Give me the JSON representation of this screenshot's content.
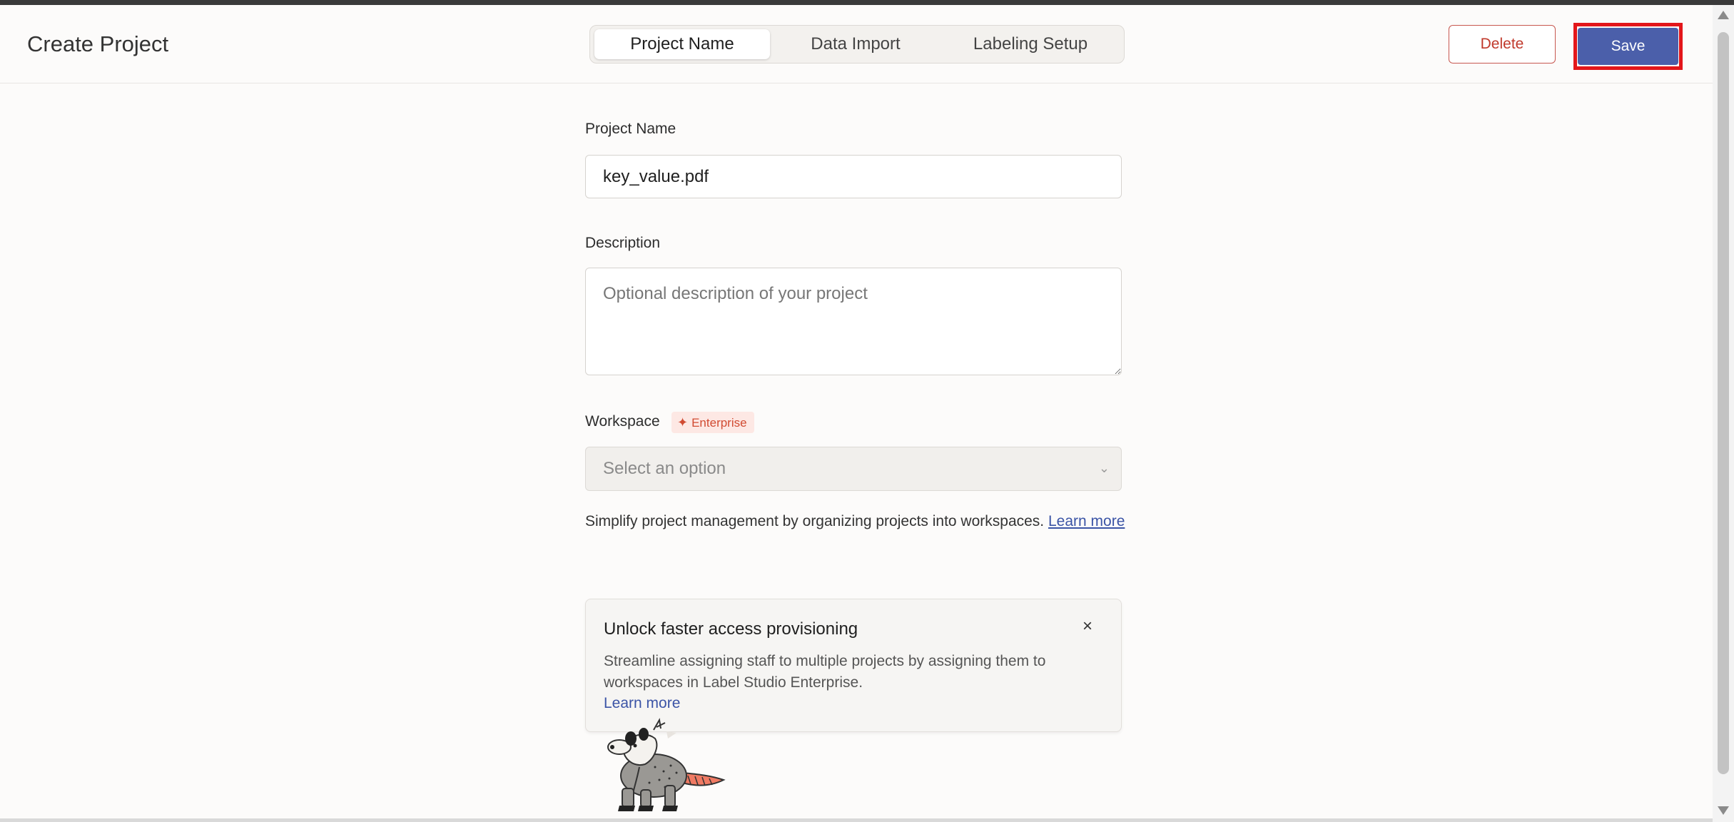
{
  "header": {
    "title": "Create Project",
    "tabs": [
      {
        "label": "Project Name",
        "active": true
      },
      {
        "label": "Data Import",
        "active": false
      },
      {
        "label": "Labeling Setup",
        "active": false
      }
    ],
    "delete_label": "Delete",
    "save_label": "Save"
  },
  "form": {
    "project_name": {
      "label": "Project Name",
      "value": "key_value.pdf"
    },
    "description": {
      "label": "Description",
      "placeholder": "Optional description of your project"
    },
    "workspace": {
      "label": "Workspace",
      "badge": "Enterprise",
      "placeholder": "Select an option",
      "help_text": "Simplify project management by organizing projects into workspaces.",
      "help_link": "Learn more"
    }
  },
  "promo": {
    "title": "Unlock faster access provisioning",
    "body": "Streamline assigning staff to multiple projects by assigning them to workspaces in Label Studio Enterprise.",
    "link": "Learn more",
    "close_symbol": "×"
  },
  "colors": {
    "accent": "#4b5faa",
    "danger": "#c0392b",
    "highlight": "#e3161a",
    "enterprise": "#d14b32"
  }
}
